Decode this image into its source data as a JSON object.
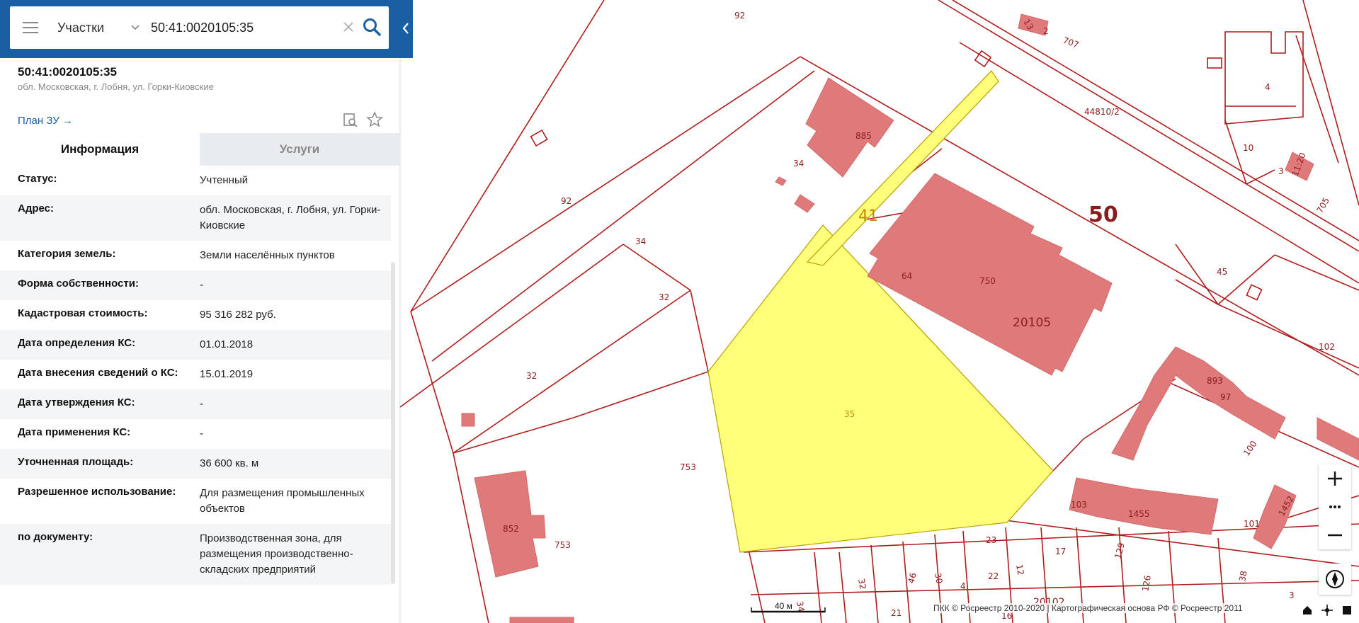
{
  "search": {
    "type_label": "Участки",
    "value": "50:41:0020105:35"
  },
  "parcel": {
    "number": "50:41:0020105:35",
    "address": "обл. Московская, г. Лобня, ул. Горки-Киовские",
    "plan_link": "План ЗУ →"
  },
  "tabs": {
    "info": "Информация",
    "services": "Услуги"
  },
  "attributes": [
    {
      "key": "Статус:",
      "value": "Учтенный"
    },
    {
      "key": "Адрес:",
      "value": "обл. Московская, г. Лобня, ул. Горки-Киовские"
    },
    {
      "key": "Категория земель:",
      "value": "Земли населённых пунктов"
    },
    {
      "key": "Форма собственности:",
      "value": "-"
    },
    {
      "key": "Кадастровая стоимость:",
      "value": "95 316 282 руб."
    },
    {
      "key": "Дата определения КС:",
      "value": "01.01.2018"
    },
    {
      "key": "Дата внесения сведений о КС:",
      "value": "15.01.2019"
    },
    {
      "key": "Дата утверждения КС:",
      "value": "-"
    },
    {
      "key": "Дата применения КС:",
      "value": "-"
    },
    {
      "key": "Уточненная площадь:",
      "value": "36 600 кв. м"
    },
    {
      "key": "Разрешенное использование:",
      "value": "Для размещения промышленных объектов"
    },
    {
      "key": "по документу:",
      "value": "Производственная зона, для размещения производственно-складских предприятий"
    }
  ],
  "map": {
    "labels": {
      "l92a": "92",
      "l92b": "92",
      "l34a": "34",
      "l34b": "34",
      "l32a": "32",
      "l32b": "32",
      "l885": "885",
      "l41": "41",
      "l50": "50",
      "l64": "64",
      "l750": "750",
      "l20105": "20105",
      "l35": "35",
      "l753a": "753",
      "l753b": "753",
      "l852": "852",
      "l44810": "44810/2",
      "l4": "4",
      "l10": "10",
      "l3": "3",
      "l1120": "11:20",
      "l705": "705",
      "l45": "45",
      "l102": "102",
      "l893": "893",
      "l97": "97",
      "l100": "100",
      "l103": "103",
      "l1455": "1455",
      "l101": "101",
      "l1452": "1452",
      "l13": "13",
      "l2": "2",
      "l707": "707",
      "l23": "23",
      "l17": "17",
      "l12": "12",
      "l129": "129",
      "l22": "22",
      "l4b": "4",
      "l30": "30",
      "l46": "46",
      "l32c": "32",
      "l34c": "34",
      "l126": "126",
      "l38": "38",
      "l20102": "20102",
      "l21": "21",
      "l16": "16",
      "l3b": "3"
    },
    "colors": {
      "parcel_border": "#b01c1c",
      "building_fill": "#e07a7a",
      "selected_fill": "#ffff7a",
      "panel_blue": "#1a5fa3"
    }
  },
  "scale": {
    "label": "40 м"
  },
  "copyright": "ПКК © Росреестр 2010-2020 | Картографическая основа РФ © Росреестр 2011"
}
